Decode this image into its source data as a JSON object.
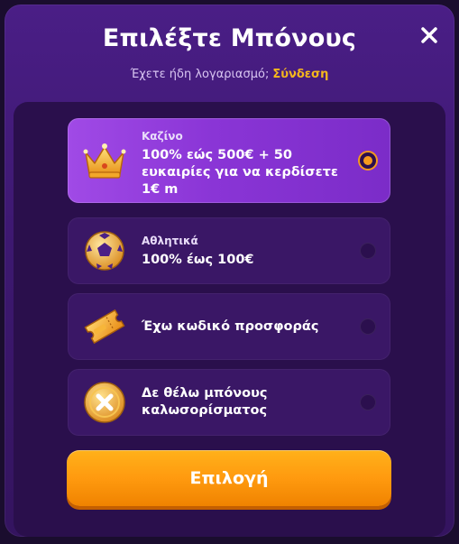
{
  "header": {
    "title": "Επιλέξτε Μπόνους",
    "login_prompt": "Έχετε ήδη λογαριασμό;",
    "login_link": "Σύνδεση"
  },
  "options": [
    {
      "category": "Καζίνο",
      "description": "100% εώς 500€ + 50 ευκαιρίες για να κερδίσετε 1€ m",
      "icon": "crown-icon",
      "selected": true
    },
    {
      "category": "Αθλητικά",
      "description": "100% έως 100€",
      "icon": "soccer-ball-icon",
      "selected": false
    },
    {
      "category": "",
      "description": "Έχω κωδικό προσφοράς",
      "icon": "ticket-icon",
      "selected": false
    },
    {
      "category": "",
      "description": "Δε θέλω μπόνους καλωσορίσματος",
      "icon": "no-bonus-coin-icon",
      "selected": false
    }
  ],
  "cta_label": "Επιλογή",
  "colors": {
    "accent": "#f59a1e",
    "selected_card": "#9b45e0",
    "panel": "#2a0f4c",
    "link": "#f6b81c"
  }
}
